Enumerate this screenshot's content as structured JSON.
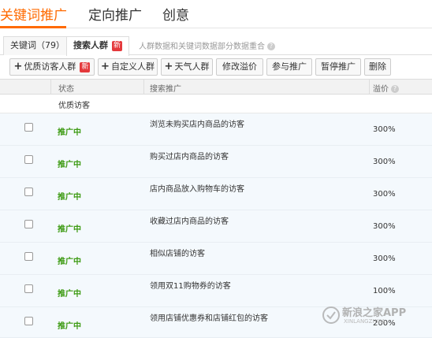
{
  "top_tabs": [
    "关键词推广",
    "定向推广",
    "创意"
  ],
  "sub_tabs": {
    "keywords": "关键词（79）",
    "audience": "搜索人群",
    "new_badge": "新",
    "note": "人群数据和关键词数据部分数据重合",
    "help": "?"
  },
  "toolbar": {
    "quality_visitors": "优质访客人群",
    "new_badge": "新",
    "custom": "自定义人群",
    "weather": "天气人群",
    "edit_bid": "修改溢价",
    "join": "参与推广",
    "pause": "暂停推广",
    "delete": "删除",
    "plus": "+"
  },
  "table": {
    "headers": {
      "status": "状态",
      "audience": "搜索推广",
      "bid": "溢价",
      "help": "?"
    },
    "group": "优质访客",
    "rows": [
      {
        "status": "推广中",
        "name": "浏览未购买店内商品的访客",
        "bid": "300%"
      },
      {
        "status": "推广中",
        "name": "购买过店内商品的访客",
        "bid": "300%"
      },
      {
        "status": "推广中",
        "name": "店内商品放入购物车的访客",
        "bid": "300%"
      },
      {
        "status": "推广中",
        "name": "收藏过店内商品的访客",
        "bid": "300%"
      },
      {
        "status": "推广中",
        "name": "相似店铺的访客",
        "bid": "300%"
      },
      {
        "status": "推广中",
        "name": "领用双11购物券的访客",
        "bid": "100%"
      },
      {
        "status": "推广中",
        "name": "领用店铺优惠券和店铺红包的访客",
        "bid": "200%"
      }
    ]
  },
  "watermark": {
    "text": "新浪之家APP",
    "sub": "XINLANGZHIJIA"
  }
}
